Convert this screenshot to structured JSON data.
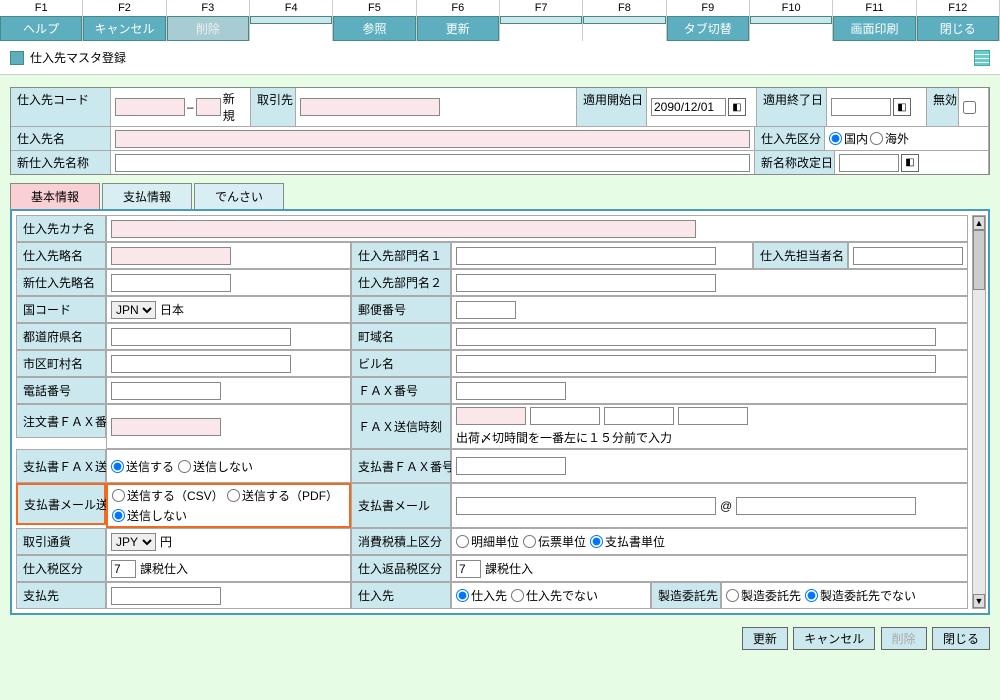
{
  "fkeys": [
    {
      "key": "F1",
      "label": "ヘルプ",
      "state": "on"
    },
    {
      "key": "F2",
      "label": "キャンセル",
      "state": "on"
    },
    {
      "key": "F3",
      "label": "削除",
      "state": "disabled"
    },
    {
      "key": "F4",
      "label": "",
      "state": "empty"
    },
    {
      "key": "F5",
      "label": "参照",
      "state": "on"
    },
    {
      "key": "F6",
      "label": "更新",
      "state": "on"
    },
    {
      "key": "F7",
      "label": "",
      "state": "empty"
    },
    {
      "key": "F8",
      "label": "",
      "state": "empty"
    },
    {
      "key": "F9",
      "label": "タブ切替",
      "state": "on"
    },
    {
      "key": "F10",
      "label": "",
      "state": "empty"
    },
    {
      "key": "F11",
      "label": "画面印刷",
      "state": "on"
    },
    {
      "key": "F12",
      "label": "閉じる",
      "state": "on"
    }
  ],
  "title": "仕入先マスタ登録",
  "header": {
    "vendor_code_label": "仕入先コード",
    "new_label": "新規",
    "partner_label": "取引先",
    "apply_start_label": "適用開始日",
    "apply_start_value": "2090/12/01",
    "apply_end_label": "適用終了日",
    "invalid_label": "無効",
    "vendor_name_label": "仕入先名",
    "vendor_class_label": "仕入先区分",
    "radio_domestic": "国内",
    "radio_overseas": "海外",
    "new_vendor_name_label": "新仕入先名称",
    "newname_rev_label": "新名称改定日"
  },
  "tabs": {
    "t1": "基本情報",
    "t2": "支払情報",
    "t3": "でんさい"
  },
  "grid": {
    "kana": "仕入先カナ名",
    "short": "仕入先略名",
    "dept1": "仕入先部門名１",
    "person": "仕入先担当者名",
    "newshort": "新仕入先略名",
    "dept2": "仕入先部門名２",
    "country": "国コード",
    "country_val": "JPN",
    "country_name": "日本",
    "postal": "郵便番号",
    "pref": "都道府県名",
    "town": "町域名",
    "city": "市区町村名",
    "bldg": "ビル名",
    "tel": "電話番号",
    "fax": "ＦＡＸ番号",
    "orderfax": "注文書ＦＡＸ番号",
    "faxtime": "ＦＡＸ送信時刻",
    "faxtime_hint": "出荷〆切時間を一番左に１５分前で入力",
    "payfax_send": "支払書ＦＡＸ送信",
    "send_yes": "送信する",
    "send_no": "送信しない",
    "payfax_no": "支払書ＦＡＸ番号",
    "paymail_send": "支払書メール送信",
    "send_csv": "送信する（CSV）",
    "send_pdf": "送信する（PDF）",
    "paymail": "支払書メール",
    "at": "@",
    "currency": "取引通貨",
    "currency_val": "JPY",
    "yen": "円",
    "taxsum": "消費税積上区分",
    "tax_detail": "明細単位",
    "tax_slip": "伝票単位",
    "tax_pay": "支払書単位",
    "purch_tax": "仕入税区分",
    "tax_val": "7",
    "tax_name": "課税仕入",
    "return_tax": "仕入返品税区分",
    "payee": "支払先",
    "purch_from": "仕入先",
    "pf_yes": "仕入先",
    "pf_no": "仕入先でない",
    "mfg": "製造委託先",
    "mfg_yes": "製造委託先",
    "mfg_no": "製造委託先でない"
  },
  "footer": {
    "update": "更新",
    "cancel": "キャンセル",
    "delete": "削除",
    "close": "閉じる"
  }
}
